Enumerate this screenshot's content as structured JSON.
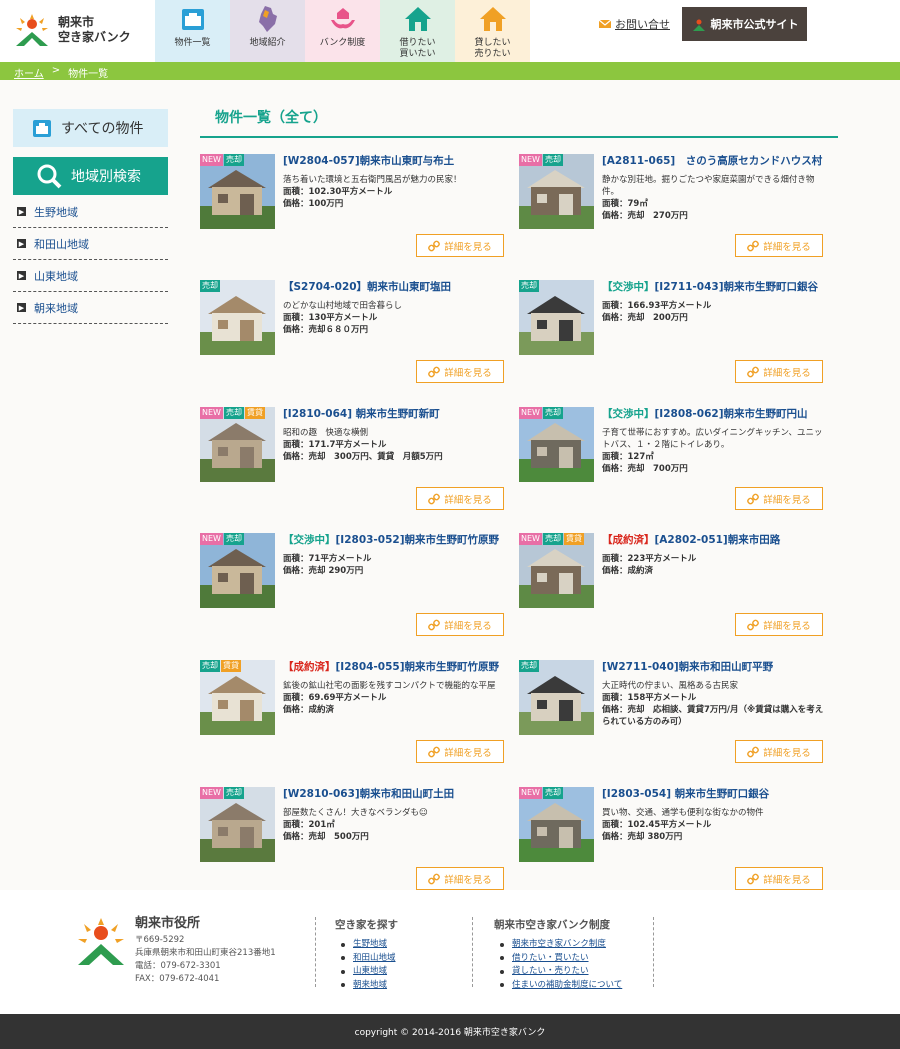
{
  "header": {
    "logo_line1": "朝来市",
    "logo_line2": "空き家バンク",
    "nav": [
      {
        "label": "物件一覧"
      },
      {
        "label": "地域紹介"
      },
      {
        "label": "バンク制度"
      },
      {
        "label": "借りたい\n買いたい"
      },
      {
        "label": "貸したい\n売りたい"
      }
    ],
    "contact": "お問い合せ",
    "official": "朝来市公式サイト"
  },
  "breadcrumb": {
    "home": "ホーム",
    "sep": ">",
    "current": "物件一覧"
  },
  "sidebar": {
    "all": "すべての物件",
    "search": "地域別検索",
    "areas": [
      "生野地域",
      "和田山地域",
      "山東地域",
      "朝来地域"
    ]
  },
  "main": {
    "title": "物件一覧（全て）",
    "detail_label": "詳細を見る",
    "cards": [
      {
        "badges": [
          "NEW",
          "売却"
        ],
        "tag": "",
        "title": "[W2804-057]朝来市山東町与布土",
        "lines": [
          "落ち着いた環境と五右衛門風呂が魅力の民家！"
        ],
        "area": "面積：102.30平方メートル",
        "price": "価格：100万円"
      },
      {
        "badges": [
          "NEW",
          "売却"
        ],
        "tag": "",
        "title": "[A2811-065]　さのう高原セカンドハウス村",
        "lines": [
          "静かな別荘地。掘りごたつや家庭菜園ができる畑付き物件。"
        ],
        "area": "面積：79㎡",
        "price": "価格：売却　270万円"
      },
      {
        "badges": [
          "売却"
        ],
        "tag": "",
        "title": "【S2704-020】朝来市山東町塩田",
        "lines": [
          "のどかな山村地域で田舎暮らし"
        ],
        "area": "面積：130平方メートル",
        "price": "価格：売却６８０万円"
      },
      {
        "badges": [
          "売却"
        ],
        "tag": "【交渉中】",
        "title": "[I2711-043]朝来市生野町口銀谷",
        "lines": [],
        "area": "面積：166.93平方メートル",
        "price": "価格：売却　200万円"
      },
      {
        "badges": [
          "NEW",
          "売却",
          "賃貸"
        ],
        "tag": "",
        "title": "[I2810-064] 朝来市生野町新町",
        "lines": [
          "昭和の趣　快適な横側"
        ],
        "area": "面積：171.7平方メートル",
        "price": "価格：売却　300万円、賃貸　月額5万円"
      },
      {
        "badges": [
          "NEW",
          "売却"
        ],
        "tag": "【交渉中】",
        "title": "[I2808-062]朝来市生野町円山",
        "lines": [
          "子育て世帯におすすめ。広いダイニングキッチン、ユニットバス、１・２階にトイレあり。"
        ],
        "area": "面積：127㎡",
        "price": "価格：売却　700万円"
      },
      {
        "badges": [
          "NEW",
          "売却"
        ],
        "tag": "【交渉中】",
        "title": "[I2803-052]朝来市生野町竹原野",
        "lines": [],
        "area": "面積：71平方メートル",
        "price": "価格：売却 290万円"
      },
      {
        "badges": [
          "NEW",
          "売却",
          "賃貸"
        ],
        "tag": "【成約済】",
        "tag_red": true,
        "title": "[A2802-051]朝来市田路",
        "lines": [],
        "area": "面積：223平方メートル",
        "price": "価格：成約済"
      },
      {
        "badges": [
          "売却",
          "賃貸"
        ],
        "tag": "【成約済】",
        "tag_red": true,
        "title": "[I2804-055]朝来市生野町竹原野",
        "lines": [
          "鉱後の鉱山社宅の面影を残すコンパクトで機能的な平屋"
        ],
        "area": "面積：69.69平方メートル",
        "price": "価格：成約済"
      },
      {
        "badges": [
          "売却"
        ],
        "tag": "",
        "title": "[W2711-040]朝来市和田山町平野",
        "lines": [
          "大正時代の佇まい、風格ある古民家"
        ],
        "area": "面積：158平方メートル",
        "price": "価格：売却　応相談、賃貸7万円/月（※賃貸は購入を考えられている方のみ可）"
      },
      {
        "badges": [
          "NEW",
          "売却"
        ],
        "tag": "",
        "title": "[W2810-063]朝来市和田山町土田",
        "lines": [
          "部屋数たくさん！大きなベランダも☺"
        ],
        "area": "面積：201㎡",
        "price": "価格：売却　500万円"
      },
      {
        "badges": [
          "NEW",
          "売却"
        ],
        "tag": "",
        "title": "[I2803-054] 朝来市生野町口銀谷",
        "lines": [
          "買い物、交通、通学も便利な街なかの物件"
        ],
        "area": "面積：102.45平方メートル",
        "price": "価格：売却 380万円"
      }
    ]
  },
  "footer": {
    "office": "朝来市役所",
    "postal": "〒669-5292",
    "address": "兵庫県朝来市和田山町東谷213番地1",
    "tel": "電話：079-672-3301",
    "fax": "FAX：079-672-4041",
    "col1_title": "空き家を探す",
    "col1": [
      "生野地域",
      "和田山地域",
      "山東地域",
      "朝来地域"
    ],
    "col2_title": "朝来市空き家バンク制度",
    "col2": [
      "朝来市空き家バンク制度",
      "借りたい・買いたい",
      "貸したい・売りたい",
      "住まいの補助金制度について"
    ],
    "copyright": "copyright © 2014-2016 朝来市空き家バンク"
  },
  "colors": {
    "accent": "#16a38d",
    "green_bar": "#8cc63f",
    "orange": "#f0a025",
    "link": "#1a4f8f",
    "footer_dark": "#333333"
  }
}
